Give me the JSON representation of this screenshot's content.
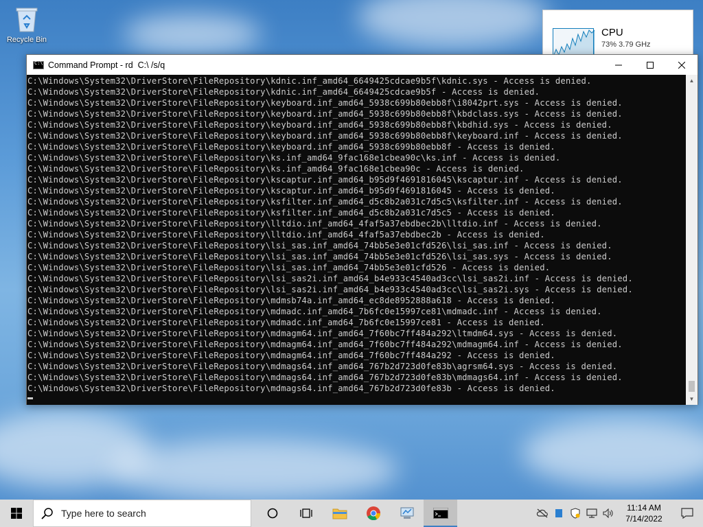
{
  "desktop": {
    "recycle_bin_label": "Recycle Bin"
  },
  "cpu_widget": {
    "title": "CPU",
    "usage": "73%  3.79 GHz"
  },
  "window": {
    "title": "Command Prompt - rd  C:\\ /s/q",
    "minimize": "—",
    "maximize": "☐",
    "close": "✕"
  },
  "console": {
    "lines": [
      "C:\\Windows\\System32\\DriverStore\\FileRepository\\kdnic.inf_amd64_6649425cdcae9b5f\\kdnic.sys - Access is denied.",
      "C:\\Windows\\System32\\DriverStore\\FileRepository\\kdnic.inf_amd64_6649425cdcae9b5f - Access is denied.",
      "C:\\Windows\\System32\\DriverStore\\FileRepository\\keyboard.inf_amd64_5938c699b80ebb8f\\i8042prt.sys - Access is denied.",
      "C:\\Windows\\System32\\DriverStore\\FileRepository\\keyboard.inf_amd64_5938c699b80ebb8f\\kbdclass.sys - Access is denied.",
      "C:\\Windows\\System32\\DriverStore\\FileRepository\\keyboard.inf_amd64_5938c699b80ebb8f\\kbdhid.sys - Access is denied.",
      "C:\\Windows\\System32\\DriverStore\\FileRepository\\keyboard.inf_amd64_5938c699b80ebb8f\\keyboard.inf - Access is denied.",
      "C:\\Windows\\System32\\DriverStore\\FileRepository\\keyboard.inf_amd64_5938c699b80ebb8f - Access is denied.",
      "C:\\Windows\\System32\\DriverStore\\FileRepository\\ks.inf_amd64_9fac168e1cbea90c\\ks.inf - Access is denied.",
      "C:\\Windows\\System32\\DriverStore\\FileRepository\\ks.inf_amd64_9fac168e1cbea90c - Access is denied.",
      "C:\\Windows\\System32\\DriverStore\\FileRepository\\kscaptur.inf_amd64_b95d9f4691816045\\kscaptur.inf - Access is denied.",
      "C:\\Windows\\System32\\DriverStore\\FileRepository\\kscaptur.inf_amd64_b95d9f4691816045 - Access is denied.",
      "C:\\Windows\\System32\\DriverStore\\FileRepository\\ksfilter.inf_amd64_d5c8b2a031c7d5c5\\ksfilter.inf - Access is denied.",
      "C:\\Windows\\System32\\DriverStore\\FileRepository\\ksfilter.inf_amd64_d5c8b2a031c7d5c5 - Access is denied.",
      "C:\\Windows\\System32\\DriverStore\\FileRepository\\lltdio.inf_amd64_4faf5a37ebdbec2b\\lltdio.inf - Access is denied.",
      "C:\\Windows\\System32\\DriverStore\\FileRepository\\lltdio.inf_amd64_4faf5a37ebdbec2b - Access is denied.",
      "C:\\Windows\\System32\\DriverStore\\FileRepository\\lsi_sas.inf_amd64_74bb5e3e01cfd526\\lsi_sas.inf - Access is denied.",
      "C:\\Windows\\System32\\DriverStore\\FileRepository\\lsi_sas.inf_amd64_74bb5e3e01cfd526\\lsi_sas.sys - Access is denied.",
      "C:\\Windows\\System32\\DriverStore\\FileRepository\\lsi_sas.inf_amd64_74bb5e3e01cfd526 - Access is denied.",
      "C:\\Windows\\System32\\DriverStore\\FileRepository\\lsi_sas2i.inf_amd64_b4e933c4540ad3cc\\lsi_sas2i.inf - Access is denied.",
      "C:\\Windows\\System32\\DriverStore\\FileRepository\\lsi_sas2i.inf_amd64_b4e933c4540ad3cc\\lsi_sas2i.sys - Access is denied.",
      "C:\\Windows\\System32\\DriverStore\\FileRepository\\mdmsb74a.inf_amd64_ec8de8952888a618 - Access is denied.",
      "C:\\Windows\\System32\\DriverStore\\FileRepository\\mdmadc.inf_amd64_7b6fc0e15997ce81\\mdmadc.inf - Access is denied.",
      "C:\\Windows\\System32\\DriverStore\\FileRepository\\mdmadc.inf_amd64_7b6fc0e15997ce81 - Access is denied.",
      "C:\\Windows\\System32\\DriverStore\\FileRepository\\mdmagm64.inf_amd64_7f60bc7ff484a292\\ltmdm64.sys - Access is denied.",
      "C:\\Windows\\System32\\DriverStore\\FileRepository\\mdmagm64.inf_amd64_7f60bc7ff484a292\\mdmagm64.inf - Access is denied.",
      "C:\\Windows\\System32\\DriverStore\\FileRepository\\mdmagm64.inf_amd64_7f60bc7ff484a292 - Access is denied.",
      "C:\\Windows\\System32\\DriverStore\\FileRepository\\mdmags64.inf_amd64_767b2d723d0fe83b\\agrsm64.sys - Access is denied.",
      "C:\\Windows\\System32\\DriverStore\\FileRepository\\mdmags64.inf_amd64_767b2d723d0fe83b\\mdmags64.inf - Access is denied.",
      "C:\\Windows\\System32\\DriverStore\\FileRepository\\mdmags64.inf_amd64_767b2d723d0fe83b - Access is denied."
    ]
  },
  "taskbar": {
    "search_placeholder": "Type here to search",
    "icons": [
      "windows-logo-icon",
      "search-icon",
      "cortana-circle-icon",
      "task-view-icon",
      "file-explorer-icon",
      "chrome-icon",
      "control-panel-icon",
      "command-prompt-icon"
    ],
    "active_app": "command-prompt-icon",
    "accent_color": "#3d7fc4"
  },
  "tray": {
    "time": "11:14 AM",
    "date": "7/14/2022"
  }
}
